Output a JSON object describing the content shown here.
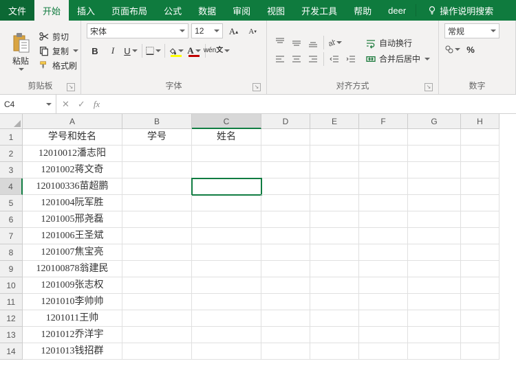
{
  "tabs": {
    "file": "文件",
    "home": "开始",
    "insert": "插入",
    "layout": "页面布局",
    "formulas": "公式",
    "data": "数据",
    "review": "审阅",
    "view": "视图",
    "dev": "开发工具",
    "help": "帮助",
    "deer": "deer",
    "tellme": "操作说明搜索"
  },
  "clipboard": {
    "paste": "粘贴",
    "cut": "剪切",
    "copy": "复制",
    "painter": "格式刷",
    "label": "剪贴板"
  },
  "font": {
    "name": "宋体",
    "size": "12",
    "label": "字体"
  },
  "align": {
    "wrap": "自动换行",
    "merge": "合并后居中",
    "label": "对齐方式"
  },
  "number": {
    "format": "常规",
    "label": "数字"
  },
  "nameBox": "C4",
  "columns": [
    "A",
    "B",
    "C",
    "D",
    "E",
    "F",
    "G",
    "H"
  ],
  "rows": [
    {
      "n": "1",
      "a": "学号和姓名",
      "b": "学号",
      "c": "姓名"
    },
    {
      "n": "2",
      "a": "12010012潘志阳",
      "b": "",
      "c": ""
    },
    {
      "n": "3",
      "a": "1201002蒋文奇",
      "b": "",
      "c": ""
    },
    {
      "n": "4",
      "a": "120100336苗超鹏",
      "b": "",
      "c": ""
    },
    {
      "n": "5",
      "a": "1201004阮军胜",
      "b": "",
      "c": ""
    },
    {
      "n": "6",
      "a": "1201005邢尧磊",
      "b": "",
      "c": ""
    },
    {
      "n": "7",
      "a": "1201006王圣斌",
      "b": "",
      "c": ""
    },
    {
      "n": "8",
      "a": "1201007焦宝亮",
      "b": "",
      "c": ""
    },
    {
      "n": "9",
      "a": "120100878翁建民",
      "b": "",
      "c": ""
    },
    {
      "n": "10",
      "a": "1201009张志权",
      "b": "",
      "c": ""
    },
    {
      "n": "11",
      "a": "1201010李帅帅",
      "b": "",
      "c": ""
    },
    {
      "n": "12",
      "a": "1201011王帅",
      "b": "",
      "c": ""
    },
    {
      "n": "13",
      "a": "1201012乔洋宇",
      "b": "",
      "c": ""
    },
    {
      "n": "14",
      "a": "1201013钱招群",
      "b": "",
      "c": ""
    }
  ],
  "activeCell": {
    "row": 4,
    "col": "C"
  }
}
